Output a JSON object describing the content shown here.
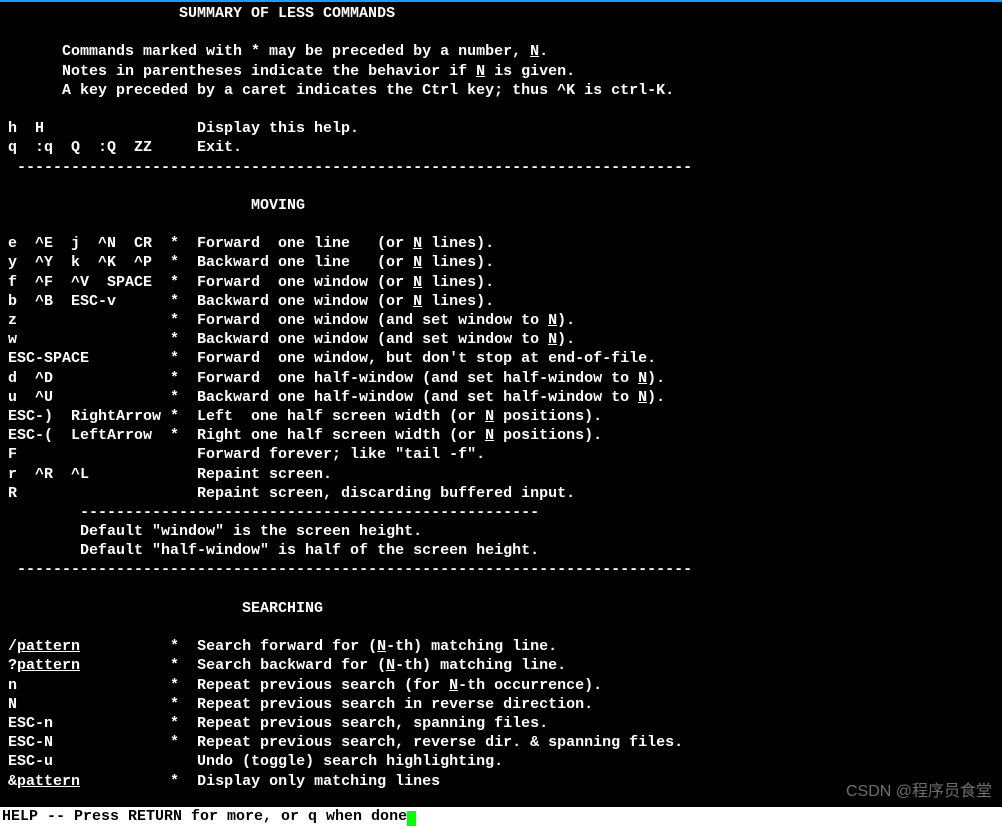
{
  "header": {
    "title": "SUMMARY OF LESS COMMANDS",
    "intro1_a": "Commands marked with * may be preceded by a number, ",
    "intro1_b": ".",
    "intro2_a": "Notes in parentheses indicate the behavior if ",
    "intro2_b": " is given.",
    "intro3": "A key preceded by a caret indicates the Ctrl key; thus ^K is ctrl-K.",
    "N": "N"
  },
  "basic": [
    {
      "keys": "h  H                 ",
      "desc": "Display this help."
    },
    {
      "keys": "q  :q  Q  :Q  ZZ     ",
      "desc": "Exit."
    }
  ],
  "hr": "---------------------------------------------------------------------------",
  "moving": {
    "title": "MOVING",
    "rows": [
      {
        "keys": "e  ^E  j  ^N  CR  *  ",
        "pre": "Forward  one line   (or ",
        "u": "N",
        "post": " lines)."
      },
      {
        "keys": "y  ^Y  k  ^K  ^P  *  ",
        "pre": "Backward one line   (or ",
        "u": "N",
        "post": " lines)."
      },
      {
        "keys": "f  ^F  ^V  SPACE  *  ",
        "pre": "Forward  one window (or ",
        "u": "N",
        "post": " lines)."
      },
      {
        "keys": "b  ^B  ESC-v      *  ",
        "pre": "Backward one window (or ",
        "u": "N",
        "post": " lines)."
      },
      {
        "keys": "z                 *  ",
        "pre": "Forward  one window (and set window to ",
        "u": "N",
        "post": ")."
      },
      {
        "keys": "w                 *  ",
        "pre": "Backward one window (and set window to ",
        "u": "N",
        "post": ")."
      },
      {
        "keys": "ESC-SPACE         *  ",
        "pre": "Forward  one window, but don't stop at end-of-file.",
        "u": "",
        "post": ""
      },
      {
        "keys": "d  ^D             *  ",
        "pre": "Forward  one half-window (and set half-window to ",
        "u": "N",
        "post": ")."
      },
      {
        "keys": "u  ^U             *  ",
        "pre": "Backward one half-window (and set half-window to ",
        "u": "N",
        "post": ")."
      },
      {
        "keys": "ESC-)  RightArrow *  ",
        "pre": "Left  one half screen width (or ",
        "u": "N",
        "post": " positions)."
      },
      {
        "keys": "ESC-(  LeftArrow  *  ",
        "pre": "Right one half screen width (or ",
        "u": "N",
        "post": " positions)."
      },
      {
        "keys": "F                    ",
        "pre": "Forward forever; like \"tail -f\".",
        "u": "",
        "post": ""
      },
      {
        "keys": "r  ^R  ^L            ",
        "pre": "Repaint screen.",
        "u": "",
        "post": ""
      },
      {
        "keys": "R                    ",
        "pre": "Repaint screen, discarding buffered input.",
        "u": "",
        "post": ""
      }
    ],
    "footer1": "Default \"window\" is the screen height.",
    "footer2": "Default \"half-window\" is half of the screen height."
  },
  "searching": {
    "title": "SEARCHING",
    "rows": [
      {
        "prefix": "/",
        "upat": "pattern",
        "pad": "          *  ",
        "pre": "Search forward for (",
        "u": "N",
        "post": "-th) matching line."
      },
      {
        "prefix": "?",
        "upat": "pattern",
        "pad": "          *  ",
        "pre": "Search backward for (",
        "u": "N",
        "post": "-th) matching line."
      },
      {
        "prefix": "n",
        "upat": "",
        "pad": "                 *  ",
        "pre": "Repeat previous search (for ",
        "u": "N",
        "post": "-th occurrence)."
      },
      {
        "prefix": "N",
        "upat": "",
        "pad": "                 *  ",
        "pre": "Repeat previous search in reverse direction.",
        "u": "",
        "post": ""
      },
      {
        "prefix": "ESC-n",
        "upat": "",
        "pad": "             *  ",
        "pre": "Repeat previous search, spanning files.",
        "u": "",
        "post": ""
      },
      {
        "prefix": "ESC-N",
        "upat": "",
        "pad": "             *  ",
        "pre": "Repeat previous search, reverse dir. & spanning files.",
        "u": "",
        "post": ""
      },
      {
        "prefix": "ESC-u",
        "upat": "",
        "pad": "                ",
        "pre": "Undo (toggle) search highlighting.",
        "u": "",
        "post": ""
      },
      {
        "prefix": "&",
        "upat": "pattern",
        "pad": "          *  ",
        "pre": "Display only matching lines",
        "u": "",
        "post": ""
      }
    ]
  },
  "status": "HELP -- Press RETURN for more, or q when done",
  "watermark": "CSDN @程序员食堂"
}
